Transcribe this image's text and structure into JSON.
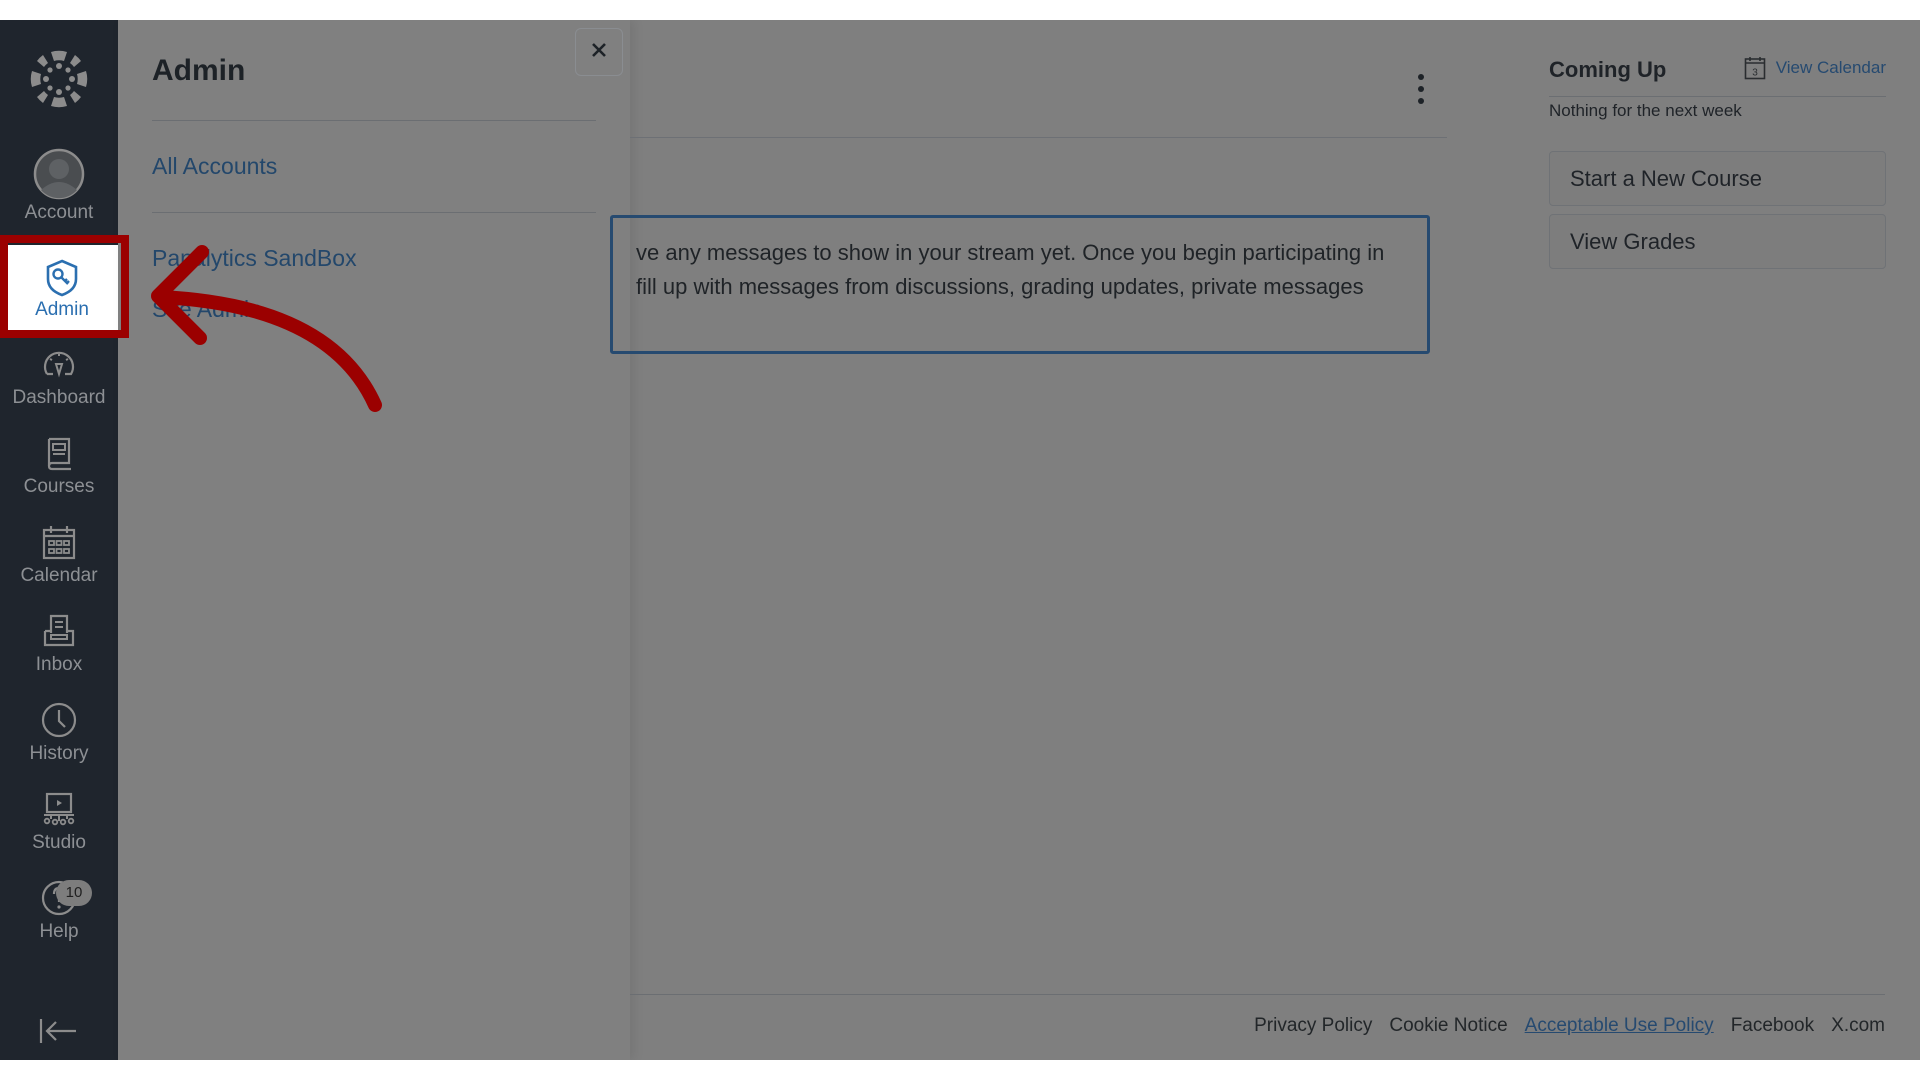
{
  "global_nav": {
    "logo": "canvas-logo-icon",
    "items": [
      {
        "label": "Account",
        "icon": "avatar-icon"
      },
      {
        "label": "Admin",
        "icon": "admin-shield-key-icon",
        "active": true
      },
      {
        "label": "Dashboard",
        "icon": "dashboard-gauge-icon"
      },
      {
        "label": "Courses",
        "icon": "book-icon"
      },
      {
        "label": "Calendar",
        "icon": "calendar-icon"
      },
      {
        "label": "Inbox",
        "icon": "inbox-icon"
      },
      {
        "label": "History",
        "icon": "clock-icon"
      },
      {
        "label": "Studio",
        "icon": "studio-icon"
      },
      {
        "label": "Help",
        "icon": "help-icon",
        "badge": "10"
      }
    ],
    "collapse_icon": "collapse-arrow-icon"
  },
  "tray": {
    "title": "Admin",
    "close_icon": "close-icon",
    "links": [
      "All Accounts",
      "Panalytics SandBox",
      "Site Admin"
    ],
    "visible_links": [
      "All Accounts",
      "Pa dalytics SandBox",
      "Site Admin"
    ]
  },
  "main": {
    "options_icon": "kebab-menu-icon",
    "stream_message": {
      "line1": "ve any messages to show in your stream yet. Once you begin participating in",
      "line2": "fill up with messages from discussions, grading updates, private messages"
    }
  },
  "right_side": {
    "coming_up_title": "Coming Up",
    "view_calendar": "View Calendar",
    "calendar_icon_day": "3",
    "empty_text": "Nothing for the next week",
    "buttons": [
      "Start a New Course",
      "View Grades"
    ]
  },
  "footer": {
    "links": [
      "Privacy Policy",
      "Cookie Notice",
      "Acceptable Use Policy",
      "Facebook",
      "X.com"
    ]
  },
  "colors": {
    "nav_bg": "#1f252d",
    "overlay_gray": "#7f7f7f",
    "link_blue": "#264a70",
    "active_label": "#2b6fb0",
    "annotation_red": "#9b0000"
  }
}
